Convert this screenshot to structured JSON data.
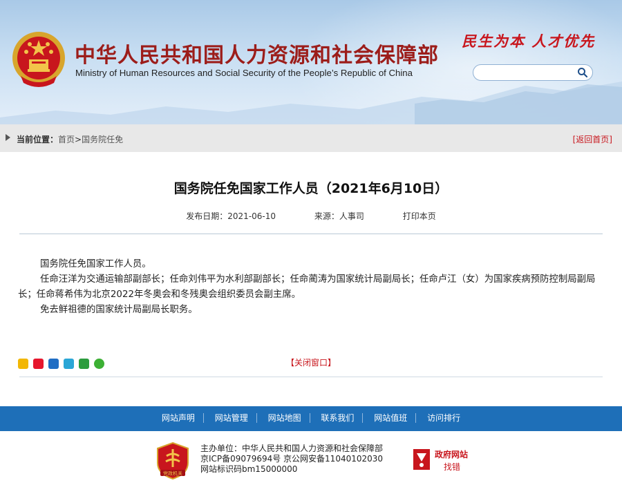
{
  "header": {
    "title_cn": "中华人民共和国人力资源和社会保障部",
    "title_en": "Ministry of Human Resources and Social Security of the People’s Republic of China",
    "slogan": "民生为本 人才优先",
    "search": {
      "placeholder": "",
      "icon": "search-icon"
    }
  },
  "breadcrumb": {
    "label": "当前位置：",
    "home": "首页",
    "separator": ">",
    "current": "国务院任免",
    "back_home": "[返回首页]"
  },
  "article": {
    "title": "国务院任免国家工作人员（2021年6月10日）",
    "date_label": "发布日期：2021-06-10",
    "source_label": "来源：人事司",
    "print_label": "打印本页",
    "paragraphs": [
      "国务院任免国家工作人员。",
      "任命汪洋为交通运输部副部长；任命刘伟平为水利部副部长；任命蔺涛为国家统计局副局长；任命卢江（女）为国家疾病预防控制局副局长；任命蒋希伟为北京2022年冬奥会和冬残奥会组织委员会副主席。",
      "免去鲜祖德的国家统计局副局长职务。"
    ],
    "close_window": "【关闭窗口】"
  },
  "share_icons": [
    "qzone-icon",
    "weibo-icon",
    "renren-icon",
    "kaixin-icon",
    "douban-icon",
    "wechat-icon"
  ],
  "footer_nav": [
    "网站声明",
    "网站管理",
    "网站地图",
    "联系我们",
    "网站值班",
    "访问排行"
  ],
  "footer": {
    "line1": "主办单位：中华人民共和国人力资源和社会保障部",
    "line2": "京ICP备09079694号 京公网安备11040102030",
    "line3": "网站标识码bm15000000",
    "badge_text": "党政机关",
    "gov_text1": "政府网站",
    "gov_text2": "找错"
  },
  "colors": {
    "brand_red": "#9c1d1a",
    "accent_red": "#c8161d",
    "nav_blue": "#1e6fb8",
    "crumb_bg": "#e8e8e8"
  }
}
